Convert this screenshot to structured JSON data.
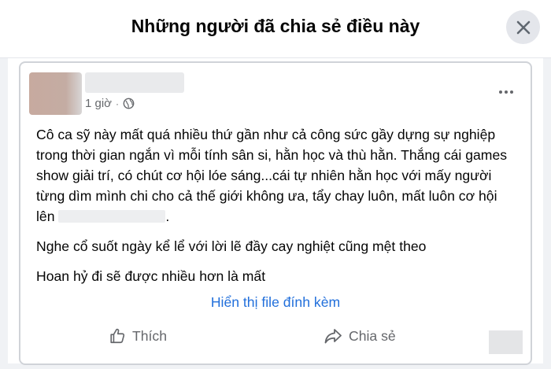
{
  "dialog": {
    "title": "Những người đã chia sẻ điều này",
    "close_icon": "close-icon"
  },
  "post": {
    "timestamp": "1 giờ",
    "separator": "·",
    "privacy_icon": "globe-icon",
    "more_icon": "more-horizontal-icon",
    "paragraph_1_part_1": "Cô ca sỹ này mất quá nhiều thứ gần như cả công sức gầy dựng sự nghiệp trong thời gian ngắn vì mỗi tính sân si, hằn học và thù hằn. Thắng cái games show giải trí, có chút cơ hội lóe sáng...cái tự nhiên hằn học với mấy người từng dìm mình chi cho cả thế giới không ưa, tẩy chay luôn, mất luôn cơ hội lên",
    "paragraph_1_part_2": ".",
    "paragraph_2": "Nghe cổ suốt ngày kể lể với lời lẽ đầy cay nghiệt cũng mệt theo",
    "paragraph_3": "Hoan hỷ đi sẽ được nhiều hơn là mất",
    "attachment_link": "Hiển thị file đính kèm"
  },
  "actions": {
    "like_label": "Thích",
    "like_icon": "thumbs-up-icon",
    "share_label": "Chia sẻ",
    "share_icon": "share-arrow-icon"
  },
  "colors": {
    "link": "#216fdb",
    "muted": "#65676b",
    "text": "#050505"
  }
}
